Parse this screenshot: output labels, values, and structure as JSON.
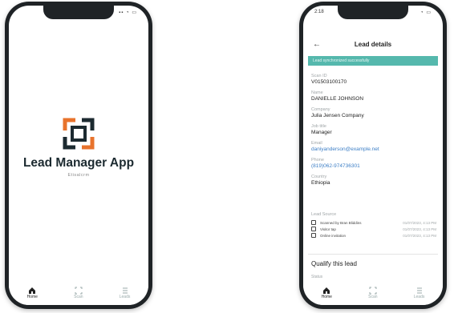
{
  "splash": {
    "status_time": "",
    "title": "Lead Manager App",
    "subtitle": "Etisalcrm"
  },
  "details": {
    "status_time": "2:18",
    "header_title": "Lead details",
    "banner": "Lead synchronized successfully",
    "fields": [
      {
        "label": "Scan ID",
        "value": "V01503100170",
        "link": false
      },
      {
        "label": "Name",
        "value": "DANIELLE JOHNSON",
        "link": false
      },
      {
        "label": "Company",
        "value": "Julia Jensen Company",
        "link": false
      },
      {
        "label": "Job title",
        "value": "Manager",
        "link": false
      },
      {
        "label": "Email",
        "value": "daniyanderson@example.net",
        "link": true
      },
      {
        "label": "Phone",
        "value": "(819)062-974736301",
        "link": true
      },
      {
        "label": "Country",
        "value": "Ethiopia",
        "link": false
      }
    ],
    "trail_title": "Lead Source",
    "trail": [
      {
        "name": "Scanned by Bran Bliddins",
        "time": "01/07/2023, 4:13 PM"
      },
      {
        "name": "Visitor tap",
        "time": "01/07/2023, 4:13 PM"
      },
      {
        "name": "Online invitation",
        "time": "01/07/2023, 4:13 PM"
      }
    ],
    "qualify": "Qualify this lead",
    "status_label": "Status"
  },
  "nav": {
    "left": [
      {
        "label": "Home",
        "icon": "home-icon"
      },
      {
        "label": "Scan",
        "icon": "scan-icon"
      },
      {
        "label": "Leads",
        "icon": "list-icon"
      }
    ],
    "right": [
      {
        "label": "Home",
        "icon": "home-icon"
      },
      {
        "label": "Scan",
        "icon": "scan-icon"
      },
      {
        "label": "Leads",
        "icon": "list-icon"
      }
    ]
  },
  "colors": {
    "accent": "#55b8ad",
    "logo_orange": "#e8732c",
    "logo_dark": "#1c2a30",
    "link": "#3d7fc6"
  }
}
